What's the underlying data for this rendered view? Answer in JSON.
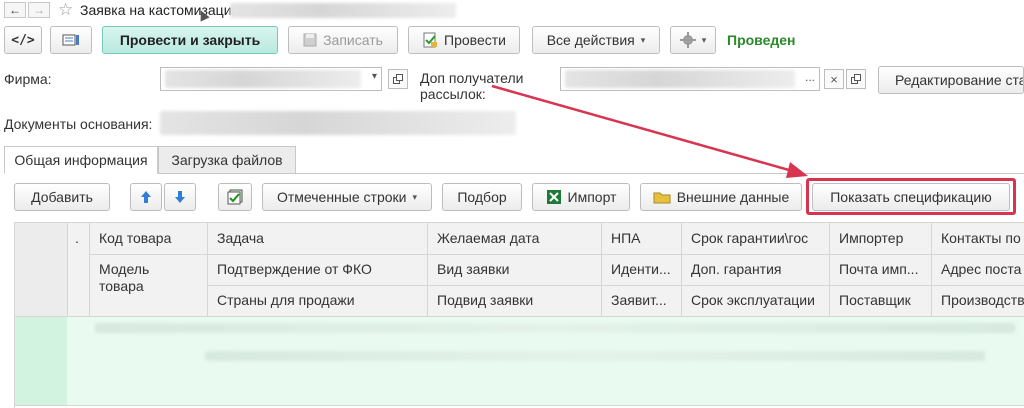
{
  "window": {
    "title": "Заявка на кастомизацию",
    "back_arrow": "←",
    "forward_arrow": "→",
    "star": "☆",
    "status": "Проведен"
  },
  "toolbar": {
    "code_icon": "</>",
    "post_close": "Провести и закрыть",
    "save": "Записать",
    "post": "Провести",
    "all_actions": "Все действия",
    "dropdown_arrow": "▾"
  },
  "form": {
    "firm_label": "Фирма:",
    "recipients_label_1": "Доп получатели",
    "recipients_label_2": "рассылок:",
    "edit_button": "Редактирование ста",
    "basis_label": "Документы основания:",
    "ellipsis": "...",
    "clear": "×"
  },
  "tabs": [
    "Общая информация",
    "Загрузка файлов"
  ],
  "tab_toolbar": {
    "add": "Добавить",
    "marked_rows": "Отмеченные строки",
    "selection": "Подбор",
    "import": "Импорт",
    "external_data": "Внешние данные",
    "show_spec": "Показать спецификацию"
  },
  "table": {
    "dot_col": ".",
    "rows": [
      [
        "Код товара",
        "Задача",
        "Желаемая дата",
        "НПА",
        "Срок гарантии\\гос",
        "Импортер",
        "Контакты по"
      ],
      [
        "Модель товара",
        "Подтверждение от ФКО",
        "Вид заявки",
        "Иденти...",
        "Доп. гарантия",
        "Почта имп...",
        "Адрес поста"
      ],
      [
        "",
        "Страны для продажи",
        "Подвид заявки",
        "Заявит...",
        "Срок эксплуатации",
        "Поставщик",
        "Производств"
      ]
    ]
  },
  "colors": {
    "primary_bg": "#bfeee3",
    "status_green": "#2a8a2a",
    "highlight_red": "#d9344f",
    "selected_row": "#e9fbf1"
  }
}
